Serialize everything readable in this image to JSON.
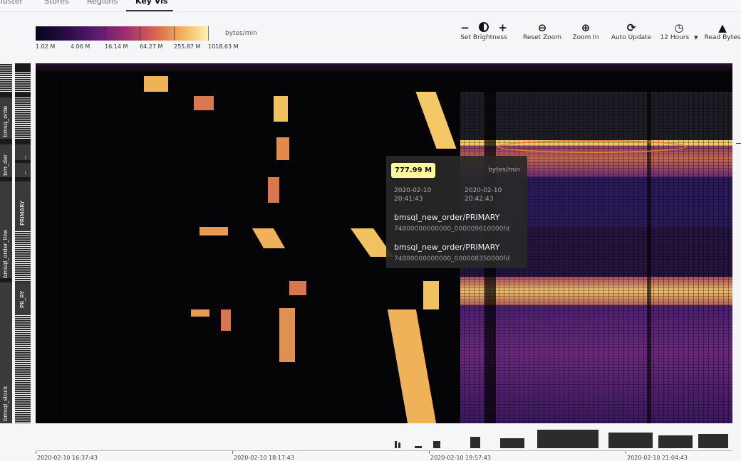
{
  "nav": {
    "tabs": [
      {
        "label": "Cluster",
        "active": false
      },
      {
        "label": "Stores",
        "active": false
      },
      {
        "label": "Regions",
        "active": false
      },
      {
        "label": "Key Vis",
        "active": true
      }
    ]
  },
  "legend": {
    "unit": "bytes/min",
    "labels": [
      "1.02 M",
      "4.06 M",
      "16.14 M",
      "64.27 M",
      "255.87 M",
      "1018.63 M"
    ]
  },
  "toolbar": {
    "brightness_label": "Set Brightness",
    "brightness_minus": "−",
    "brightness_plus": "+",
    "reset_zoom_label": "Reset Zoom",
    "zoom_in_label": "Zoom In",
    "auto_update_label": "Auto Update",
    "time_range_label": "12 Hours",
    "metric_label": "Read Bytes"
  },
  "sidebar": {
    "tables": [
      "bmsq_orde",
      "bm_der",
      "bmsql_order_line",
      "bmsql_stock"
    ],
    "indexes": [
      "_",
      "_",
      "PRIMARY",
      "PR_RY"
    ]
  },
  "tooltip": {
    "value": "777.99 M",
    "unit": "bytes/min",
    "time_start": "2020-02-10 20:41:43",
    "time_end": "2020-02-10 20:42:43",
    "start_key": "bmsql_new_order/PRIMARY",
    "start_hex": "74800000000000_000009610000fd",
    "end_key": "bmsql_new_order/PRIMARY",
    "end_hex": "74800000000000_000008350000fd"
  },
  "axis": {
    "time_labels": [
      "2020-02-10 16:37:43",
      "2020-02-10 18:17:43",
      "2020-02-10 19:57:43",
      "2020-02-10 21:04:43"
    ]
  },
  "colors": {
    "scale_low": "#07051a",
    "scale_mid": "#9b2f6d",
    "scale_high": "#fcf5b0",
    "tooltip_value_bg": "#fff89c"
  }
}
